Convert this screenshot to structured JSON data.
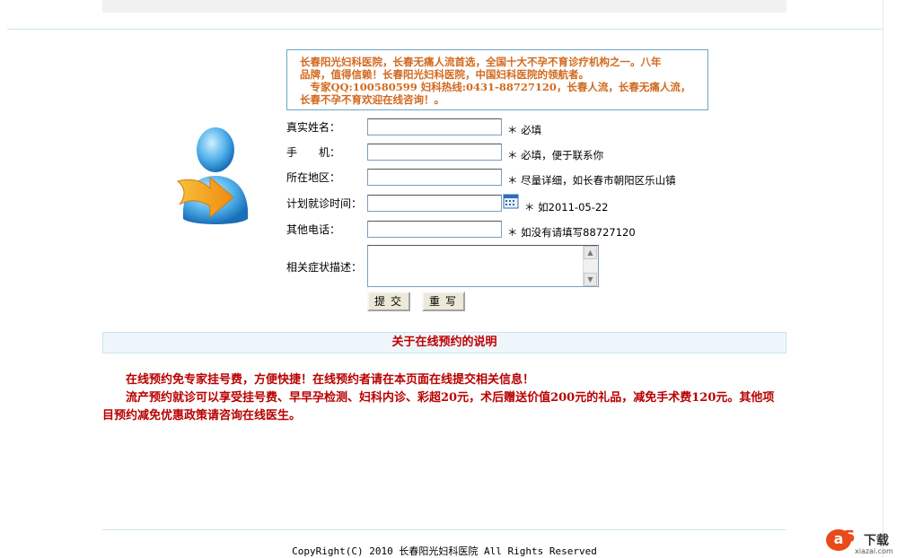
{
  "notice": {
    "lines": [
      "长春阳光妇科医院，长春无痛人流首选，全国十大不孕不育诊疗机构之一。八年",
      "品牌，值得信赖！长春阳光妇科医院，中国妇科医院的领航者。",
      "　专家QQ:100580599 妇科热线:0431-88727120，长春人流，长春无痛人流，",
      "长春不孕不育欢迎在线咨询！。"
    ]
  },
  "form": {
    "name_label": "真实姓名：",
    "name_hint": "＊ 必填",
    "phone_label": "手　　机：",
    "phone_hint": "＊ 必填，便于联系你",
    "area_label": "所在地区：",
    "area_hint": "＊ 尽量详细，如长春市朝阳区乐山镇",
    "date_label": "计划就诊时间：",
    "date_hint": "＊ 如2011-05-22",
    "other_phone_label": "其他电话：",
    "other_phone_hint": "＊ 如没有请填写88727120",
    "symptom_label": "相关症状描述：",
    "submit_label": "提交",
    "reset_label": "重写"
  },
  "section": {
    "title": "关于在线预约的说明"
  },
  "description": {
    "line1": "　　在线预约免专家挂号费，方便快捷！在线预约者请在本页面在线提交相关信息！",
    "line2": "　　流产预约就诊可以享受挂号费、早早孕检测、妇科内诊、彩超20元，术后赠送价值200元的礼品，减免手术费120元。其他项目预约减免优惠政策请咨询在线医生。"
  },
  "footer": {
    "copyright": "CopyRight(C) 2010 长春阳光妇科医院 All Rights Reserved"
  },
  "watermark": {
    "logo_a": "a",
    "logo_5": "5",
    "logo_text": "下载",
    "logo_sub": "xiazai.com"
  },
  "icons": {
    "avatar": "user-arrow-icon",
    "calendar": "calendar-icon"
  },
  "colors": {
    "notice_text": "#d2691e",
    "desc_text": "#b80000",
    "section_title": "#c00000",
    "border_blue": "#6aa6c8"
  }
}
